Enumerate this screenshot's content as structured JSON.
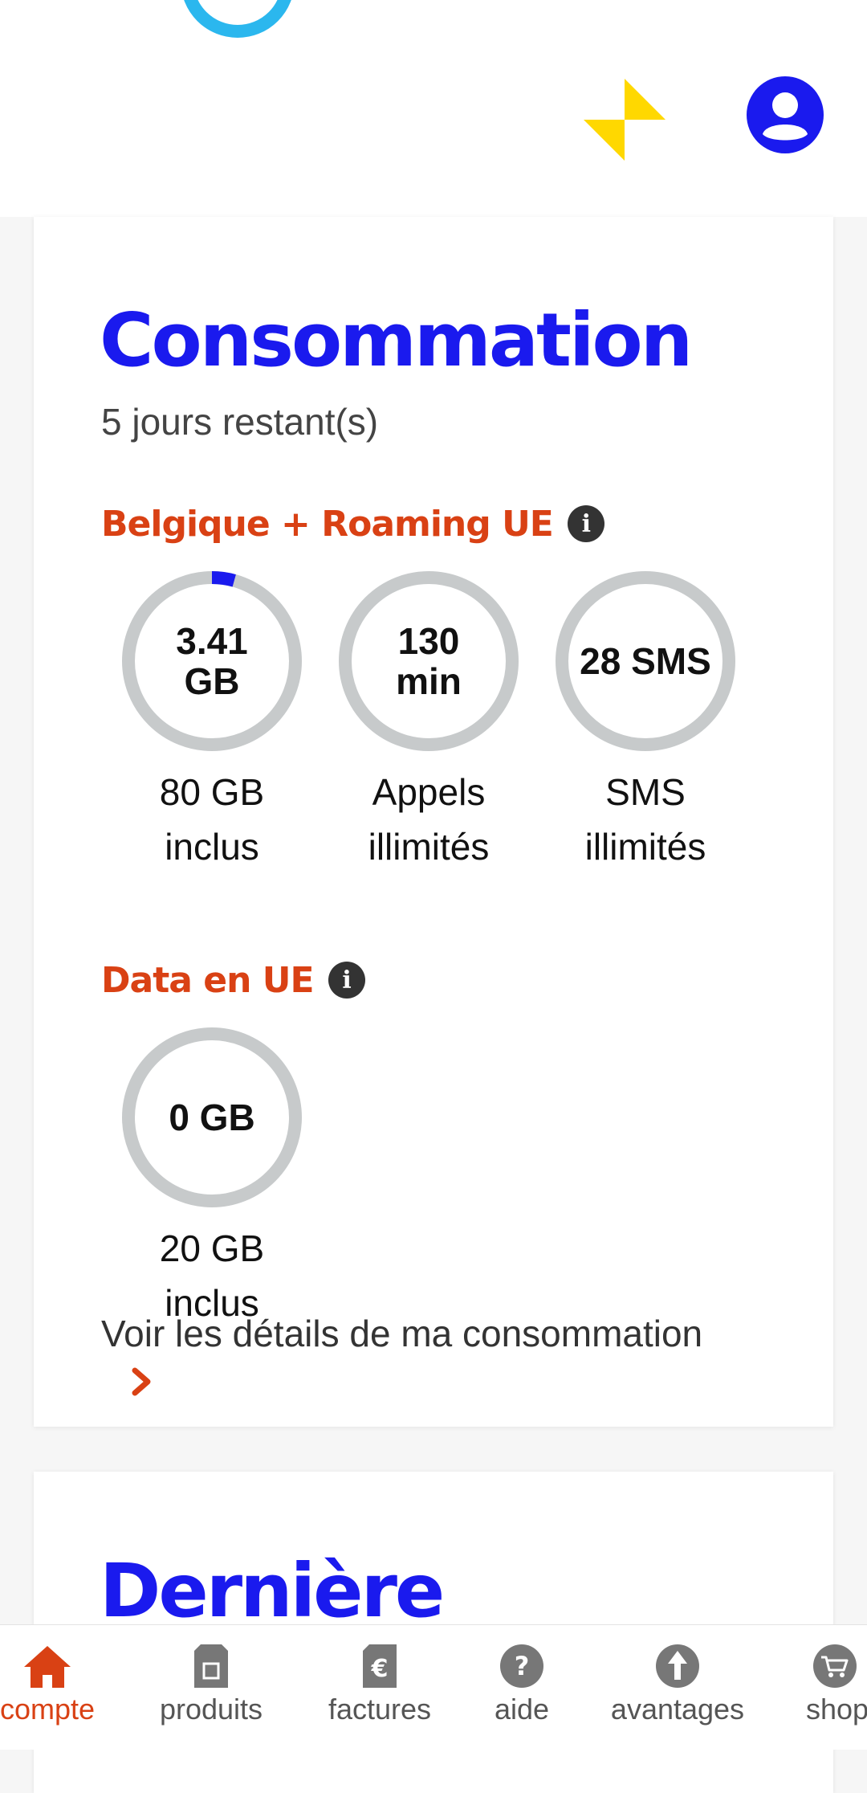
{
  "app": {
    "colors": {
      "brand_blue": "#1a1aee",
      "accent_orange": "#d94114",
      "ring_grey": "#c7cacb",
      "deco_cyan": "#2bb7ee",
      "deco_yellow": "#ffd800"
    }
  },
  "consumption": {
    "title": "Consommation",
    "days_left": "5 jours restant(s)",
    "sections": [
      {
        "heading": "Belgique + Roaming UE",
        "info_icon": "info-icon",
        "gauges": [
          {
            "value": "3.41 GB",
            "caption_lines": [
              "80 GB",
              "inclus"
            ],
            "used_fraction": 0.043
          },
          {
            "value": "130 min",
            "caption_lines": [
              "Appels",
              "illimités"
            ],
            "used_fraction": 0
          },
          {
            "value": "28 SMS",
            "caption_lines": [
              "SMS",
              "illimités"
            ],
            "used_fraction": 0
          }
        ]
      },
      {
        "heading": "Data en UE",
        "info_icon": "info-icon",
        "gauges": [
          {
            "value": "0 GB",
            "caption_lines": [
              "20 GB",
              "inclus"
            ],
            "used_fraction": 0
          }
        ]
      }
    ],
    "details_link": "Voir les détails de ma consommation"
  },
  "next_card": {
    "title": "Dernière"
  },
  "bottom_nav": {
    "items": [
      {
        "label": "compte",
        "icon": "home-icon",
        "active": true
      },
      {
        "label": "produits",
        "icon": "sim-card-icon",
        "active": false
      },
      {
        "label": "factures",
        "icon": "euro-document-icon",
        "active": false
      },
      {
        "label": "aide",
        "icon": "help-icon",
        "active": false
      },
      {
        "label": "avantages",
        "icon": "arrow-up-icon",
        "active": false
      },
      {
        "label": "shop",
        "icon": "cart-icon",
        "active": false
      }
    ]
  }
}
